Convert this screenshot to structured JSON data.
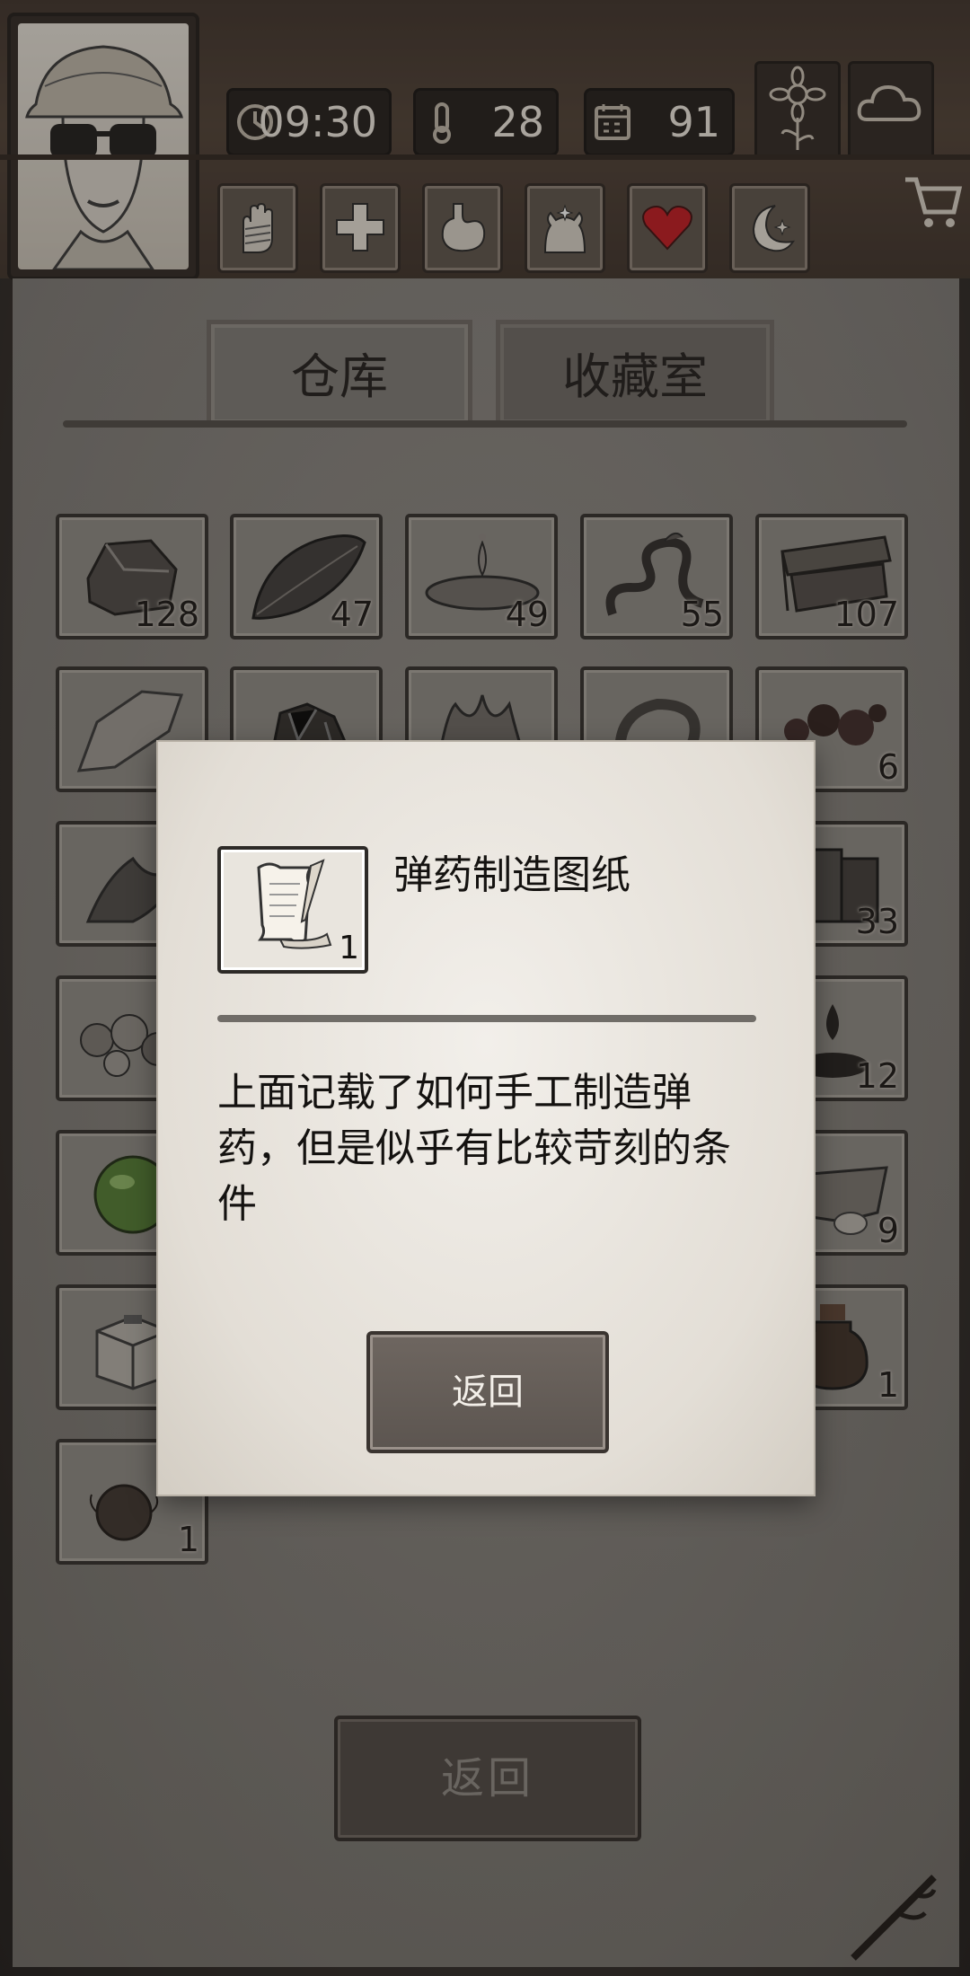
{
  "status": {
    "time": "09:30",
    "temperature": "28",
    "day": "91"
  },
  "tabs": [
    {
      "label": "仓库",
      "active": false
    },
    {
      "label": "收藏室",
      "active": true
    }
  ],
  "inventory": [
    {
      "name": "stone",
      "count": "128"
    },
    {
      "name": "leaf",
      "count": "47"
    },
    {
      "name": "water",
      "count": "49"
    },
    {
      "name": "vine",
      "count": "55"
    },
    {
      "name": "wood-plank",
      "count": "107"
    },
    {
      "name": "flint",
      "count": ""
    },
    {
      "name": "ore",
      "count": ""
    },
    {
      "name": "fiber",
      "count": ""
    },
    {
      "name": "rope",
      "count": ""
    },
    {
      "name": "berries",
      "count": "6"
    },
    {
      "name": "herb",
      "count": ""
    },
    {
      "name": "log-pile",
      "count": "33"
    },
    {
      "name": "rocks",
      "count": ""
    },
    {
      "name": "oil-drop",
      "count": "12"
    },
    {
      "name": "green-orb",
      "count": ""
    },
    {
      "name": "hide",
      "count": "9"
    },
    {
      "name": "box",
      "count": ""
    },
    {
      "name": "bottle",
      "count": "1"
    },
    {
      "name": "fur-ball",
      "count": "1"
    }
  ],
  "bottom_button": "返回",
  "modal": {
    "item_count": "1",
    "title": "弹药制造图纸",
    "description": "上面记载了如何手工制造弹药，但是似乎有比较苛刻的条件",
    "button": "返回"
  },
  "colors": {
    "paper": "#86827c",
    "wood": "#3b2f27",
    "modal": "#e9e5de",
    "heart": "#c0141c"
  }
}
